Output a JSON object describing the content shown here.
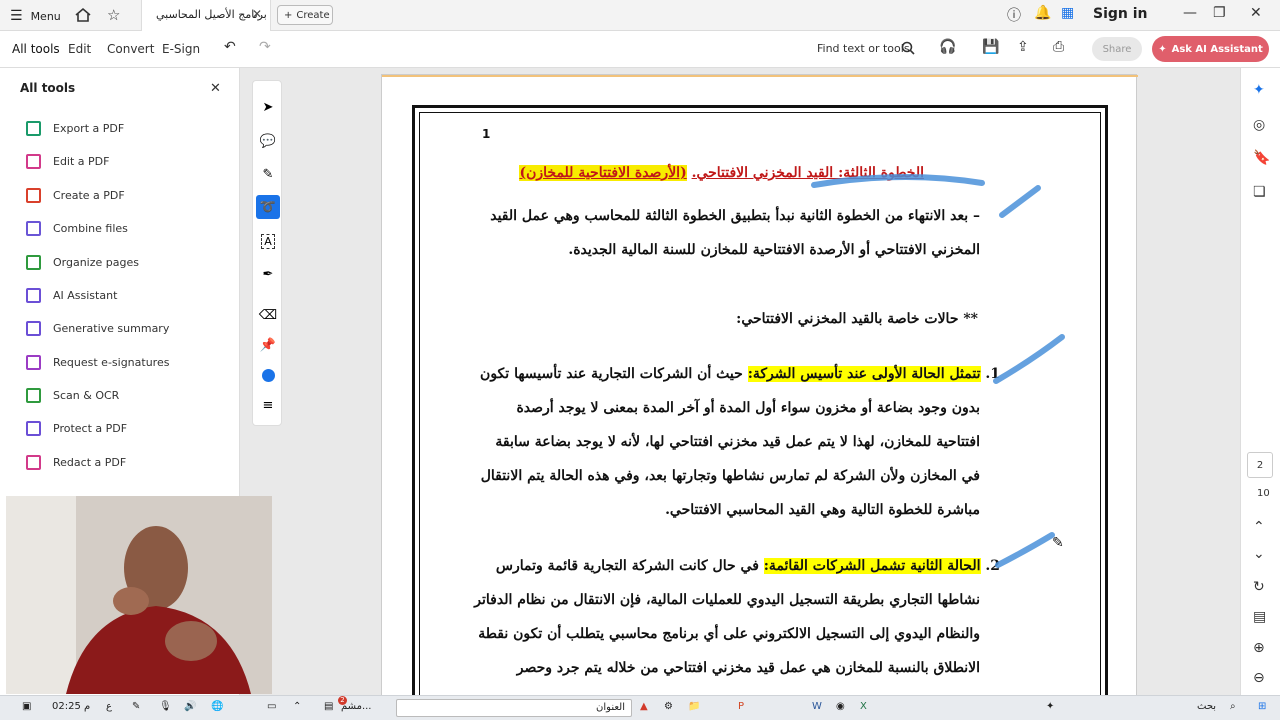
{
  "topbar": {
    "menu_label": "Menu",
    "doc_tab_title": "برنامج الأصيل المحاسبي",
    "create_label": "Create",
    "signin_label": "Sign in"
  },
  "toolbar": {
    "tabs": [
      "All tools",
      "Edit",
      "Convert",
      "E-Sign"
    ],
    "find_label": "Find text or tools",
    "share_label": "Share",
    "ask_label": "Ask AI Assistant"
  },
  "sidebar": {
    "header": "All tools",
    "items": [
      {
        "label": "Export a PDF",
        "color": "#1a9a6a"
      },
      {
        "label": "Edit a PDF",
        "color": "#d23a8a"
      },
      {
        "label": "Create a PDF",
        "color": "#d9402b"
      },
      {
        "label": "Combine files",
        "color": "#6a55d6"
      },
      {
        "label": "Organize pages",
        "color": "#2f9a3e"
      },
      {
        "label": "AI Assistant",
        "color": "#6b4fd6"
      },
      {
        "label": "Generative summary",
        "color": "#6b4fd6"
      },
      {
        "label": "Request e-signatures",
        "color": "#9b3cc4"
      },
      {
        "label": "Scan & OCR",
        "color": "#2f9a3e"
      },
      {
        "label": "Protect a PDF",
        "color": "#6b4fd6"
      },
      {
        "label": "Redact a PDF",
        "color": "#d23a8a"
      }
    ]
  },
  "document": {
    "page_number": "1",
    "title_red": "الخطوة الثالثة: القيد المخزني الافتتاحي.",
    "title_highlight": "(الأرصدة الافتتاحية للمخازن)",
    "para1_line1": "–  بعد الانتهاء من الخطوة الثانية نبدأ بتطبيق الخطوة الثالثة للمحاسب وهي عمل القيد",
    "para1_line2": "المخزني الافتتاحي أو الأرصدة الافتتاحية للمخازن للسنة المالية الجديدة.",
    "special_cases": "** حالات خاصة بالقيد المخزني الافتتاحي:",
    "case1_num": "1.",
    "case1_highlight": "تتمثل الحالة الأولى عند تأسيس الشركة:",
    "case1_line1_rest": " حيث أن الشركات التجارية عند تأسيسها تكون",
    "case1_line2": "بدون وجود بضاعة أو مخزون سواء أول المدة أو آخر المدة بمعنى لا يوجد أرصدة",
    "case1_line3": "افتتاحية للمخازن، لهذا لا يتم عمل قيد مخزني افتتاحي لها، لأنه لا يوجد بضاعة سابقة",
    "case1_line4": "في المخازن ولأن الشركة لم تمارس نشاطها وتجارتها بعد، وفي هذه الحالة يتم الانتقال",
    "case1_line5": "مباشرة للخطوة التالية وهي القيد المحاسبي الافتتاحي.",
    "case2_num": "2.",
    "case2_highlight": "الحالة الثانية تشمل الشركات القائمة:",
    "case2_line1_rest": " في حال كانت الشركة التجارية قائمة وتمارس",
    "case2_line2": "نشاطها التجاري بطريقة التسجيل اليدوي للعمليات المالية، فإن الانتقال من نظام الدفاتر",
    "case2_line3": "والنظام اليدوي إلى التسجيل الالكتروني على أي برنامج محاسبي يتطلب أن تكون نقطة",
    "case2_line4": "الانطلاق بالنسبة للمخازن هي عمل قيد مخزني افتتاحي من خلاله يتم جرد وحصر"
  },
  "rightrail": {
    "page_current": "2",
    "page_total": "10"
  },
  "taskbar": {
    "time": "02:25 م",
    "lang": "ع",
    "app_label": "مشم...",
    "search_label": "العنوان",
    "search_right": "بحث",
    "badge": "2"
  }
}
